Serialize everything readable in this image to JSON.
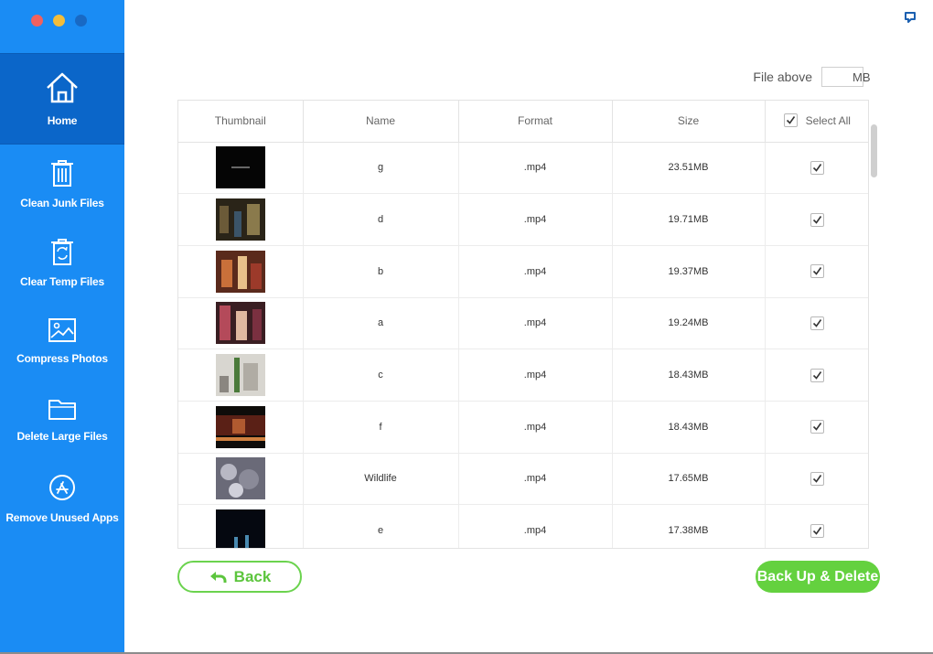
{
  "sidebar": {
    "items": [
      {
        "label": "Home",
        "icon": "home-icon"
      },
      {
        "label": "Clean Junk Files",
        "icon": "trash-icon"
      },
      {
        "label": "Clear Temp Files",
        "icon": "temp-trash-icon"
      },
      {
        "label": "Compress Photos",
        "icon": "photo-icon"
      },
      {
        "label": "Delete Large Files",
        "icon": "folder-icon"
      },
      {
        "label": "Remove Unused Apps",
        "icon": "app-store-icon"
      }
    ],
    "active": "Home"
  },
  "filter": {
    "label": "File above",
    "value": "",
    "unit": "MB"
  },
  "table": {
    "headers": [
      "Thumbnail",
      "Name",
      "Format",
      "Size",
      "Select All"
    ],
    "select_all_checked": true,
    "rows": [
      {
        "name": "g",
        "format": ".mp4",
        "size": "23.51MB",
        "checked": true
      },
      {
        "name": "d",
        "format": ".mp4",
        "size": "19.71MB",
        "checked": true
      },
      {
        "name": "b",
        "format": ".mp4",
        "size": "19.37MB",
        "checked": true
      },
      {
        "name": "a",
        "format": ".mp4",
        "size": "19.24MB",
        "checked": true
      },
      {
        "name": "c",
        "format": ".mp4",
        "size": "18.43MB",
        "checked": true
      },
      {
        "name": "f",
        "format": ".mp4",
        "size": "18.43MB",
        "checked": true
      },
      {
        "name": "Wildlife",
        "format": ".mp4",
        "size": "17.65MB",
        "checked": true
      },
      {
        "name": "e",
        "format": ".mp4",
        "size": "17.38MB",
        "checked": true
      }
    ]
  },
  "buttons": {
    "back": "Back",
    "backup_delete": "Back Up & Delete"
  },
  "colors": {
    "sidebar": "#1a8cf4",
    "sidebar_active": "#0b66c9",
    "accent_green": "#64d13f"
  }
}
